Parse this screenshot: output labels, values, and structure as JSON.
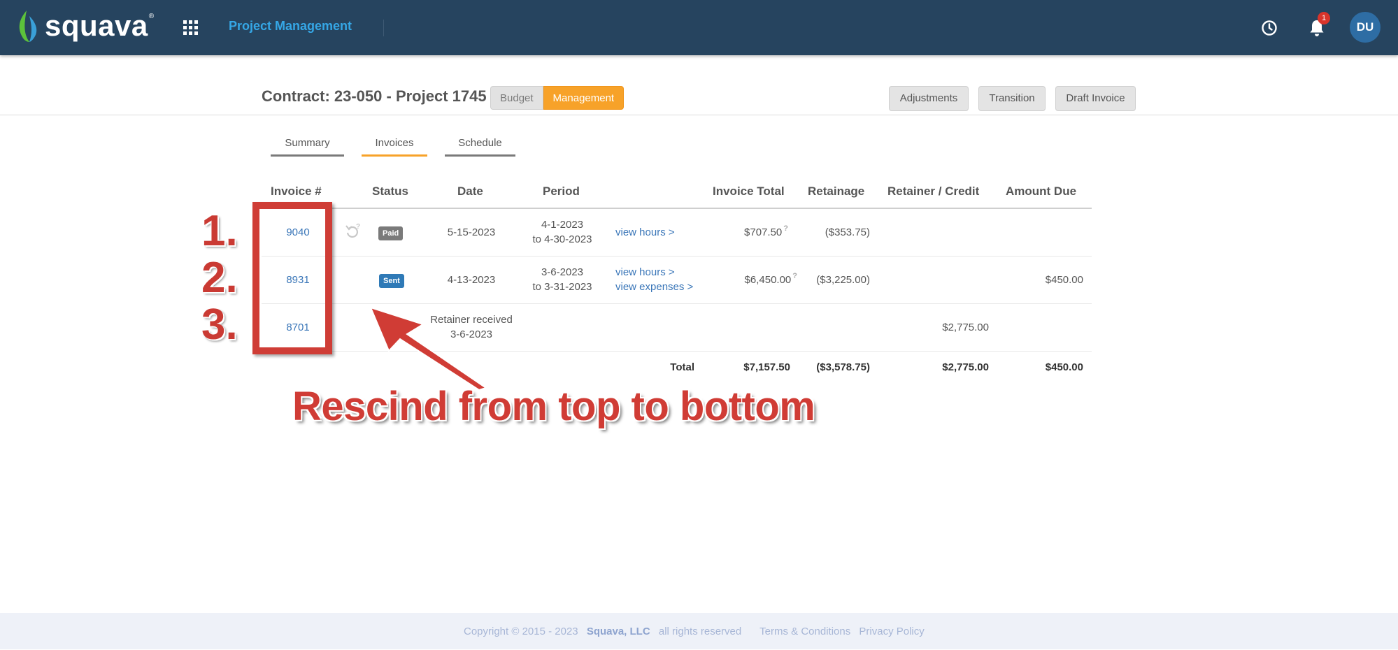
{
  "header": {
    "brand": "squava",
    "app_title": "Project Management",
    "notification_count": "1",
    "user_initials": "DU",
    "colors": {
      "bar": "#26445f",
      "accent": "#35a7e6",
      "badge": "#d9342b"
    }
  },
  "contract": {
    "title": "Contract: 23-050 - Project 1745",
    "views": {
      "budget": "Budget",
      "management": "Management"
    },
    "actions": {
      "adjustments": "Adjustments",
      "transition": "Transition",
      "draft_invoice": "Draft Invoice"
    }
  },
  "tabs": {
    "summary": "Summary",
    "invoices": "Invoices",
    "schedule": "Schedule",
    "active": "Invoices"
  },
  "table": {
    "headers": {
      "invoice": "Invoice #",
      "status": "Status",
      "date": "Date",
      "period": "Period",
      "invoice_total": "Invoice Total",
      "retainage": "Retainage",
      "retainer_credit": "Retainer / Credit",
      "amount_due": "Amount Due"
    },
    "rows": [
      {
        "invoice": "9040",
        "status": "Paid",
        "date": "5-15-2023",
        "period_start": "4-1-2023",
        "period_end": "to 4-30-2023",
        "link1": "view hours >",
        "link2": "",
        "invoice_total": "$707.50",
        "retainage": "($353.75)",
        "retainer_credit": "",
        "amount_due": ""
      },
      {
        "invoice": "8931",
        "status": "Sent",
        "date": "4-13-2023",
        "period_start": "3-6-2023",
        "period_end": "to 3-31-2023",
        "link1": "view hours >",
        "link2": "view expenses >",
        "invoice_total": "$6,450.00",
        "retainage": "($3,225.00)",
        "retainer_credit": "",
        "amount_due": "$450.00"
      },
      {
        "invoice": "8701",
        "status": "",
        "date_line1": "Retainer received",
        "date_line2": "3-6-2023",
        "retainer_credit": "$2,775.00"
      }
    ],
    "totals": {
      "label": "Total",
      "invoice_total": "$7,157.50",
      "retainage": "($3,578.75)",
      "retainer_credit": "$2,775.00",
      "amount_due": "$450.00"
    },
    "help_mark": "?"
  },
  "annotation": {
    "numbers": [
      "1.",
      "2.",
      "3."
    ],
    "text": "Rescind from top to bottom",
    "color": "#cf3d36"
  },
  "footer": {
    "copyright": "Copyright © 2015 - 2023",
    "company": "Squava, LLC",
    "rights": "all rights reserved",
    "terms": "Terms & Conditions",
    "privacy": "Privacy Policy"
  }
}
